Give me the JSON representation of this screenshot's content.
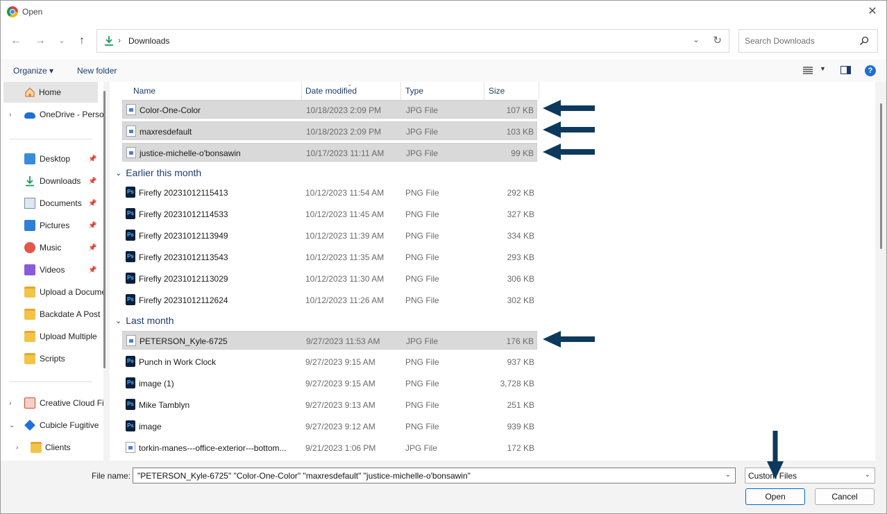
{
  "window": {
    "title": "Open"
  },
  "nav": {
    "path": "Downloads",
    "search_placeholder": "Search Downloads"
  },
  "toolbar": {
    "organize": "Organize ▾",
    "new_folder": "New folder",
    "help": "?"
  },
  "sidebar": {
    "items": [
      {
        "label": "Home"
      },
      {
        "label": "OneDrive - Personal"
      },
      {
        "label": "Desktop"
      },
      {
        "label": "Downloads"
      },
      {
        "label": "Documents"
      },
      {
        "label": "Pictures"
      },
      {
        "label": "Music"
      },
      {
        "label": "Videos"
      },
      {
        "label": "Upload a Document"
      },
      {
        "label": "Backdate A Post"
      },
      {
        "label": "Upload Multiple"
      },
      {
        "label": "Scripts"
      },
      {
        "label": "Creative Cloud Files"
      },
      {
        "label": "Cubicle Fugitive"
      },
      {
        "label": "Clients"
      }
    ]
  },
  "columns": {
    "name": "Name",
    "date": "Date modified",
    "type": "Type",
    "size": "Size"
  },
  "groups": {
    "earlier": "Earlier this month",
    "last": "Last month"
  },
  "files": [
    {
      "name": "Color-One-Color",
      "date": "10/18/2023 2:09 PM",
      "type": "JPG File",
      "size": "107 KB"
    },
    {
      "name": "maxresdefault",
      "date": "10/18/2023 2:09 PM",
      "type": "JPG File",
      "size": "103 KB"
    },
    {
      "name": "justice-michelle-o'bonsawin",
      "date": "10/17/2023 11:11 AM",
      "type": "JPG File",
      "size": "99 KB"
    },
    {
      "name": "Firefly 20231012115413",
      "date": "10/12/2023 11:54 AM",
      "type": "PNG File",
      "size": "292 KB"
    },
    {
      "name": "Firefly 20231012114533",
      "date": "10/12/2023 11:45 AM",
      "type": "PNG File",
      "size": "327 KB"
    },
    {
      "name": "Firefly 20231012113949",
      "date": "10/12/2023 11:39 AM",
      "type": "PNG File",
      "size": "334 KB"
    },
    {
      "name": "Firefly 20231012113543",
      "date": "10/12/2023 11:35 AM",
      "type": "PNG File",
      "size": "293 KB"
    },
    {
      "name": "Firefly 20231012113029",
      "date": "10/12/2023 11:30 AM",
      "type": "PNG File",
      "size": "306 KB"
    },
    {
      "name": "Firefly 20231012112624",
      "date": "10/12/2023 11:26 AM",
      "type": "PNG File",
      "size": "302 KB"
    },
    {
      "name": "PETERSON_Kyle-6725",
      "date": "9/27/2023 11:53 AM",
      "type": "JPG File",
      "size": "176 KB"
    },
    {
      "name": "Punch in Work Clock",
      "date": "9/27/2023 9:15 AM",
      "type": "PNG File",
      "size": "937 KB"
    },
    {
      "name": "image (1)",
      "date": "9/27/2023 9:15 AM",
      "type": "PNG File",
      "size": "3,728 KB"
    },
    {
      "name": "Mike Tamblyn",
      "date": "9/27/2023 9:13 AM",
      "type": "PNG File",
      "size": "251 KB"
    },
    {
      "name": "image",
      "date": "9/27/2023 9:12 AM",
      "type": "PNG File",
      "size": "939 KB"
    },
    {
      "name": "torkin-manes---office-exterior---bottom...",
      "date": "9/21/2023 1:06 PM",
      "type": "JPG File",
      "size": "172 KB"
    }
  ],
  "bottom": {
    "file_name_label": "File name:",
    "file_name_value": "\"PETERSON_Kyle-6725\" \"Color-One-Color\" \"maxresdefault\" \"justice-michelle-o'bonsawin\"",
    "filter_value": "Custom Files",
    "open_label": "Open",
    "cancel_label": "Cancel"
  },
  "colors": {
    "accent": "#1c3b6b",
    "annotation_arrow": "#0d3a5c",
    "selection": "#d9d9d9"
  }
}
